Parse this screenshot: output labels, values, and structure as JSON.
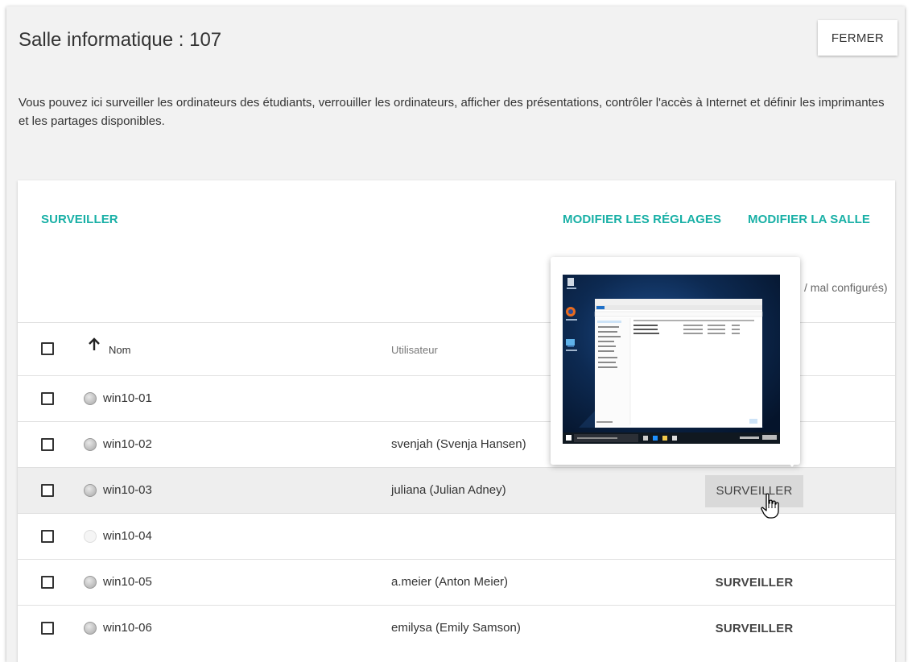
{
  "title": "Salle informatique : 107",
  "close_label": "FERMER",
  "description": "Vous pouvez ici surveiller les ordinateurs des étudiants, verrouiller les ordinateurs, afficher des présentations, contrôler l'accès à Internet et définir les imprimantes et les partages disponibles.",
  "actions": {
    "monitor": "SURVEILLER",
    "edit_settings": "MODIFIER LES RÉGLAGES",
    "edit_room": "MODIFIER LA SALLE"
  },
  "status_note": "/ mal configurés)",
  "table": {
    "col_name": "Nom",
    "col_user": "Utilisateur",
    "rows": [
      {
        "name": "win10-01",
        "user": "",
        "action": "",
        "online": true
      },
      {
        "name": "win10-02",
        "user": "svenjah (Svenja Hansen)",
        "action": "",
        "online": true
      },
      {
        "name": "win10-03",
        "user": "juliana (Julian Adney)",
        "action": "SURVEILLER",
        "online": true
      },
      {
        "name": "win10-04",
        "user": "",
        "action": "",
        "online": false
      },
      {
        "name": "win10-05",
        "user": "a.meier (Anton Meier)",
        "action": "SURVEILLER",
        "online": true
      },
      {
        "name": "win10-06",
        "user": "emilysa (Emily Samson)",
        "action": "SURVEILLER",
        "online": true
      }
    ]
  },
  "popup": {
    "icon_names": [
      "recycle-bin-icon",
      "firefox-icon",
      "computer-icon",
      "file-explorer-window",
      "taskbar"
    ]
  },
  "colors": {
    "accent": "#19b0a6",
    "panel_bg": "#f2f2f2",
    "hover_row": "#eeeeee",
    "desktop_bg": "#0d2a52"
  }
}
